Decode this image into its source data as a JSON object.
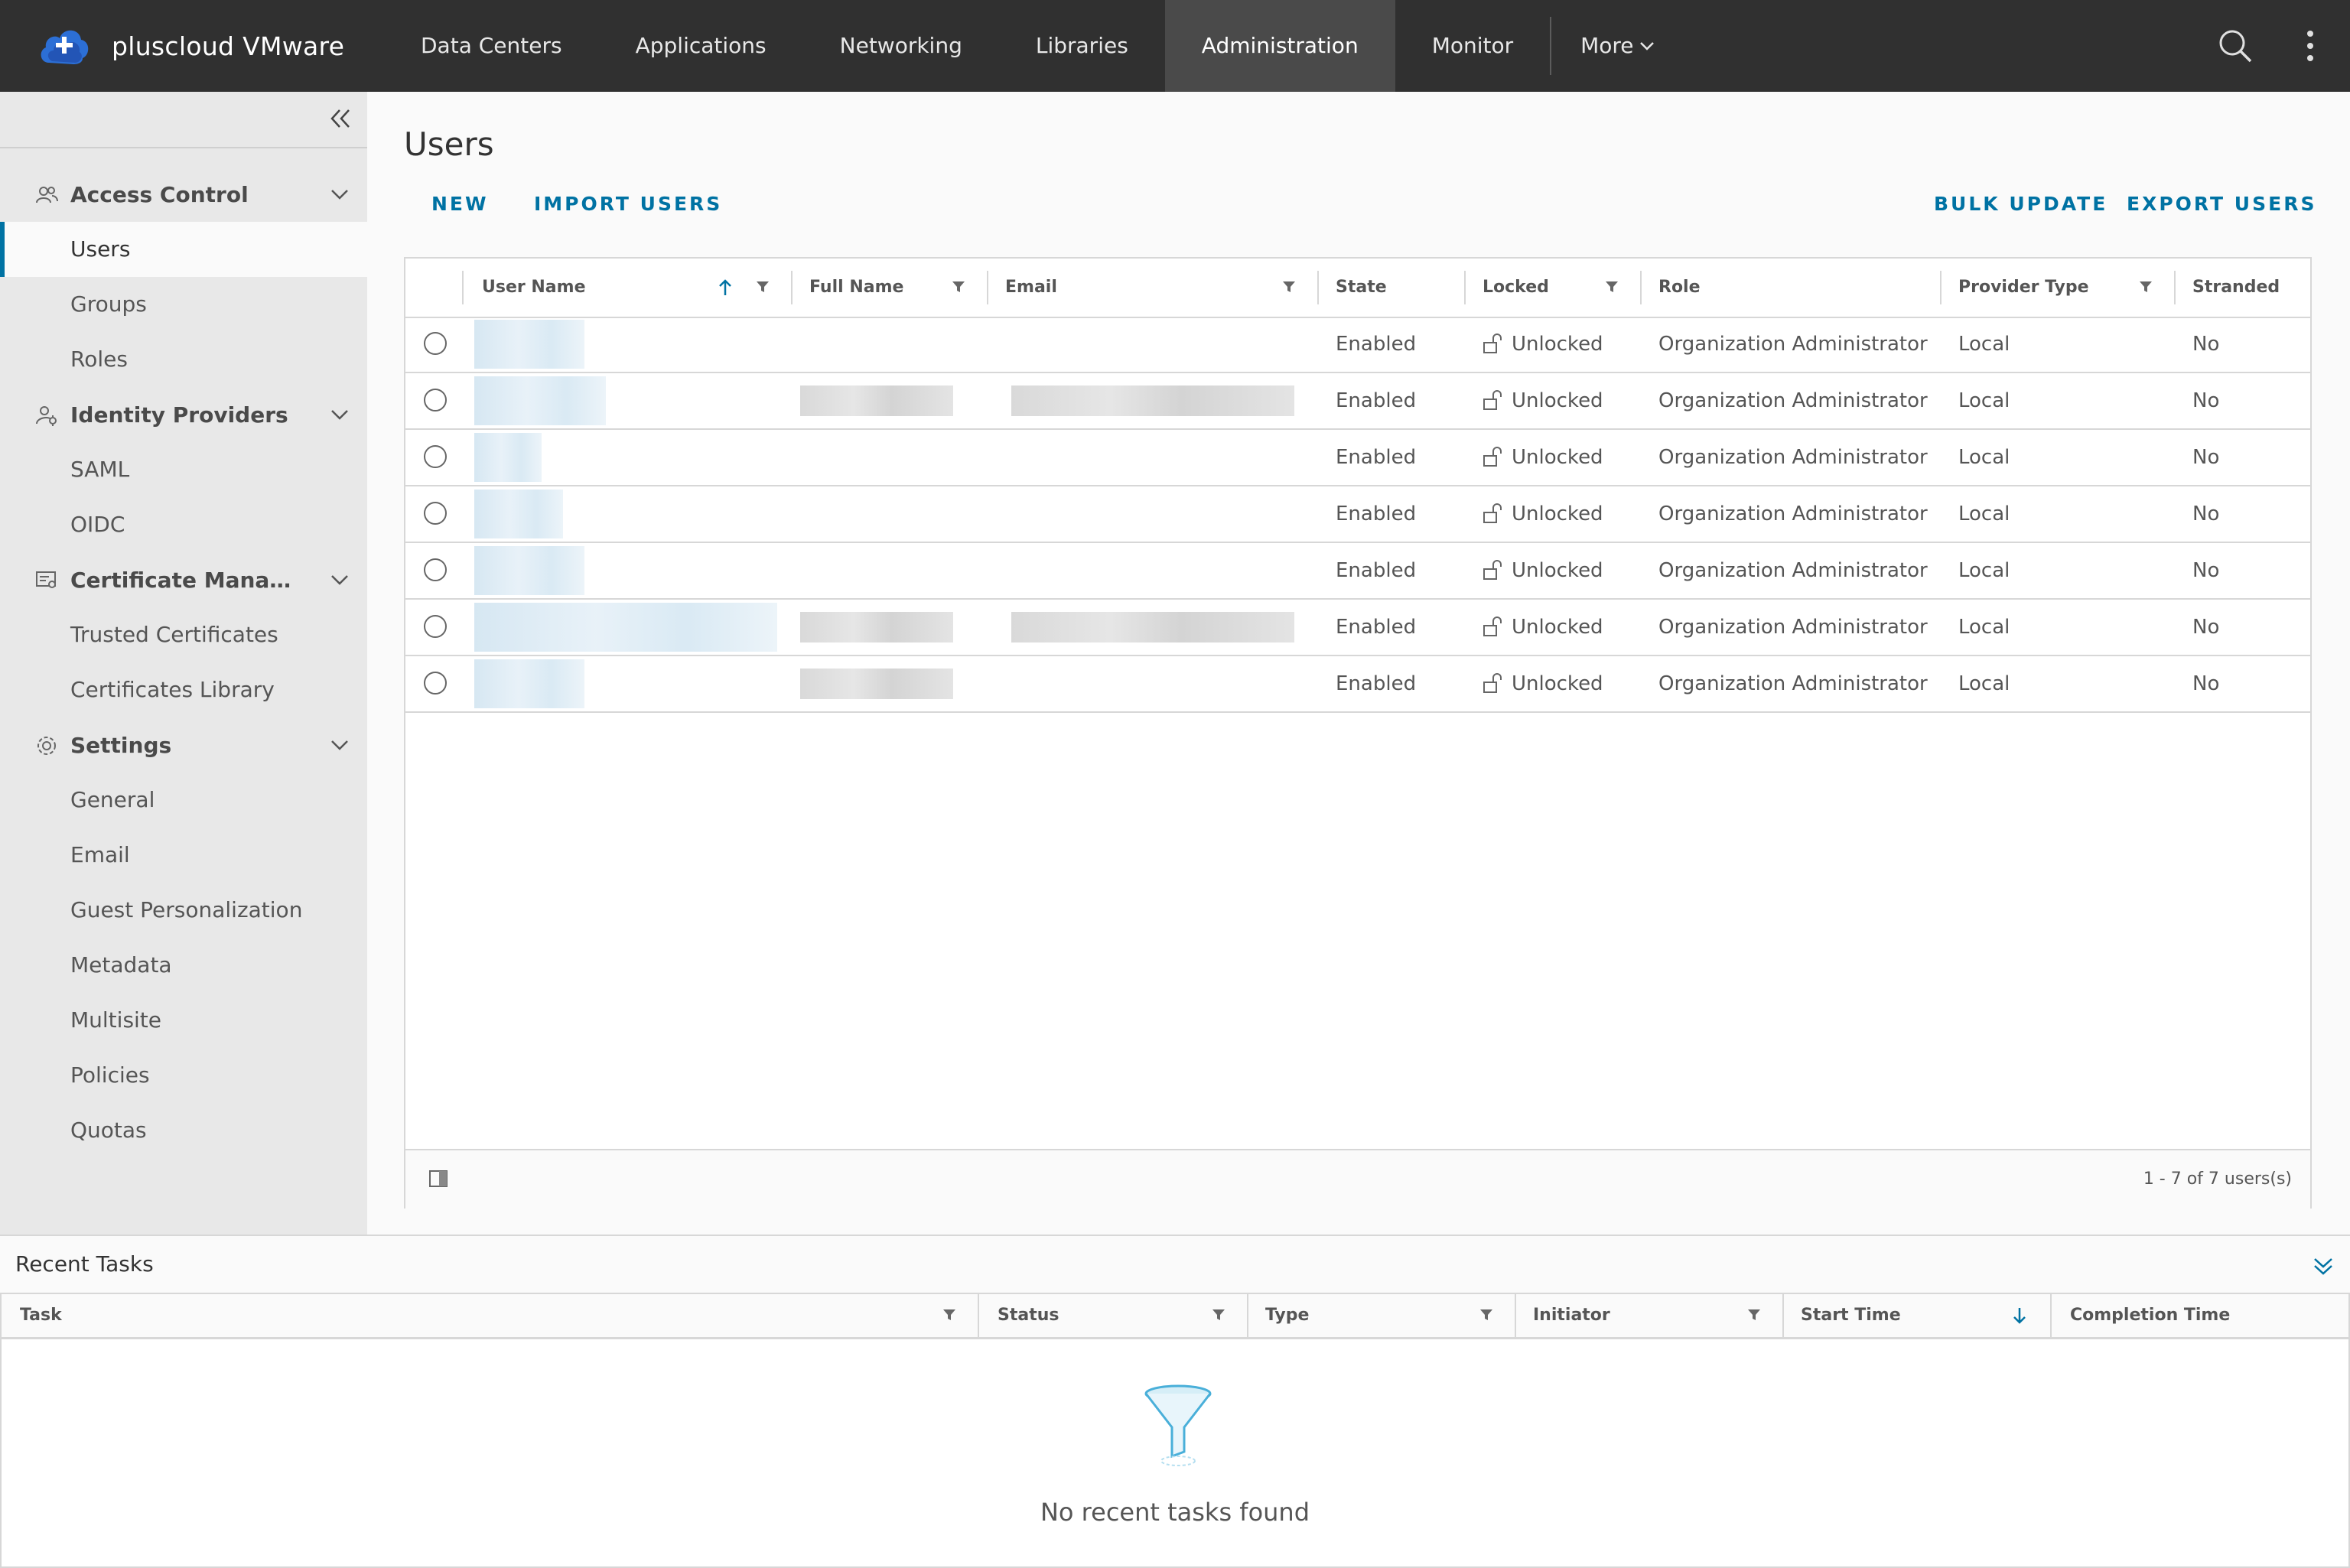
{
  "app": {
    "name": "pluscloud VMware"
  },
  "nav": {
    "items": [
      "Data Centers",
      "Applications",
      "Networking",
      "Libraries",
      "Administration",
      "Monitor"
    ],
    "active": "Administration",
    "more": "More"
  },
  "sidebar": {
    "groups": [
      {
        "label": "Access Control",
        "items": [
          "Users",
          "Groups",
          "Roles"
        ]
      },
      {
        "label": "Identity Providers",
        "items": [
          "SAML",
          "OIDC"
        ]
      },
      {
        "label": "Certificate Managem...",
        "items": [
          "Trusted Certificates",
          "Certificates Library"
        ]
      },
      {
        "label": "Settings",
        "items": [
          "General",
          "Email",
          "Guest Personalization",
          "Metadata",
          "Multisite",
          "Policies",
          "Quotas"
        ]
      }
    ],
    "active_item": "Users"
  },
  "page": {
    "title": "Users",
    "actions": {
      "new": "NEW",
      "import": "IMPORT USERS",
      "bulk_update": "BULK UPDATE",
      "export": "EXPORT USERS"
    }
  },
  "grid": {
    "columns": [
      "User Name",
      "Full Name",
      "Email",
      "State",
      "Locked",
      "Role",
      "Provider Type",
      "Stranded"
    ],
    "rows": [
      {
        "state": "Enabled",
        "locked": "Unlocked",
        "role": "Organization Administrator",
        "provider": "Local",
        "stranded": "No"
      },
      {
        "state": "Enabled",
        "locked": "Unlocked",
        "role": "Organization Administrator",
        "provider": "Local",
        "stranded": "No"
      },
      {
        "state": "Enabled",
        "locked": "Unlocked",
        "role": "Organization Administrator",
        "provider": "Local",
        "stranded": "No"
      },
      {
        "state": "Enabled",
        "locked": "Unlocked",
        "role": "Organization Administrator",
        "provider": "Local",
        "stranded": "No"
      },
      {
        "state": "Enabled",
        "locked": "Unlocked",
        "role": "Organization Administrator",
        "provider": "Local",
        "stranded": "No"
      },
      {
        "state": "Enabled",
        "locked": "Unlocked",
        "role": "Organization Administrator",
        "provider": "Local",
        "stranded": "No"
      },
      {
        "state": "Enabled",
        "locked": "Unlocked",
        "role": "Organization Administrator",
        "provider": "Local",
        "stranded": "No"
      }
    ],
    "pager": "1 - 7 of 7 users(s)"
  },
  "tasks": {
    "title": "Recent Tasks",
    "columns": [
      "Task",
      "Status",
      "Type",
      "Initiator",
      "Start Time",
      "Completion Time"
    ],
    "empty": "No recent tasks found"
  },
  "colors": {
    "accent": "#0072a3",
    "header": "#303030",
    "nav_active": "#4a4a4a",
    "sidebar": "#e8e8e8"
  },
  "icons": [
    "search-icon",
    "more-vertical-icon",
    "collapse-icon",
    "users-icon",
    "id-icon",
    "certificate-icon",
    "gear-icon",
    "chevron-down-icon",
    "filter-icon",
    "sort-up-icon",
    "sort-down-icon",
    "unlock-icon",
    "column-toggle-icon",
    "funnel-icon"
  ]
}
